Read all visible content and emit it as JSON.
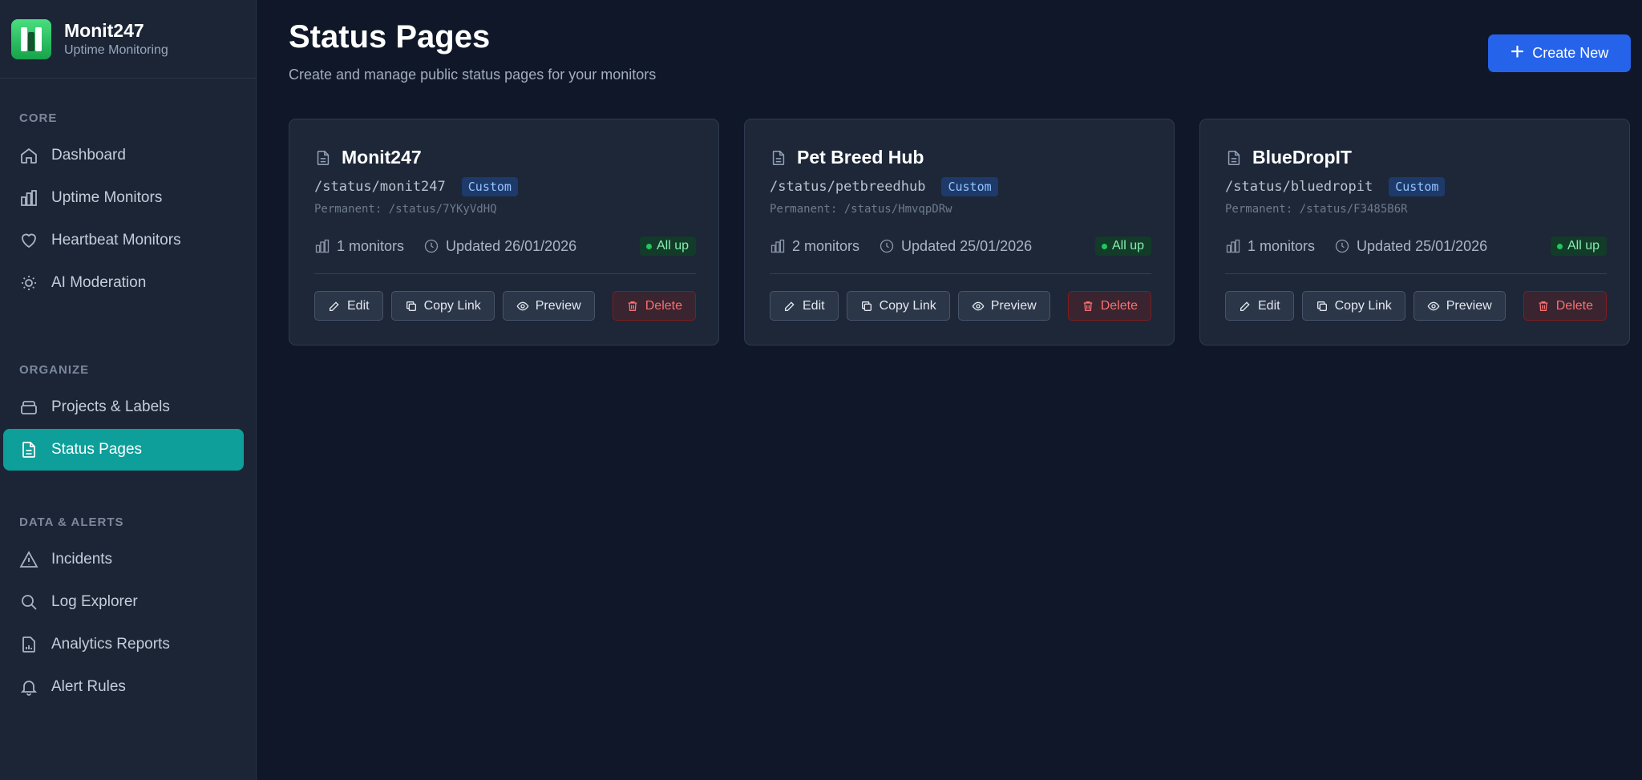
{
  "brand": {
    "name": "Monit247",
    "tagline": "Uptime Monitoring"
  },
  "sidebar": {
    "sections": [
      {
        "heading": "CORE",
        "items": [
          {
            "label": "Dashboard",
            "icon": "home-icon"
          },
          {
            "label": "Uptime Monitors",
            "icon": "bar-chart-icon"
          },
          {
            "label": "Heartbeat Monitors",
            "icon": "heart-icon"
          },
          {
            "label": "AI Moderation",
            "icon": "lightbulb-icon"
          }
        ]
      },
      {
        "heading": "ORGANIZE",
        "items": [
          {
            "label": "Projects & Labels",
            "icon": "archive-icon"
          },
          {
            "label": "Status Pages",
            "icon": "document-icon",
            "active": true
          }
        ]
      },
      {
        "heading": "DATA & ALERTS",
        "items": [
          {
            "label": "Incidents",
            "icon": "warning-icon"
          },
          {
            "label": "Log Explorer",
            "icon": "search-icon"
          },
          {
            "label": "Analytics Reports",
            "icon": "report-icon"
          },
          {
            "label": "Alert Rules",
            "icon": "bell-icon"
          }
        ]
      }
    ]
  },
  "header": {
    "title": "Status Pages",
    "subtitle": "Create and manage public status pages for your monitors",
    "create_label": "Create New"
  },
  "cards": [
    {
      "title": "Monit247",
      "slug": "/status/monit247",
      "badge": "Custom",
      "permanent": "Permanent: /status/7YKyVdHQ",
      "monitors": "1 monitors",
      "updated": "Updated 26/01/2026",
      "status": "All up"
    },
    {
      "title": "Pet Breed Hub",
      "slug": "/status/petbreedhub",
      "badge": "Custom",
      "permanent": "Permanent: /status/HmvqpDRw",
      "monitors": "2 monitors",
      "updated": "Updated 25/01/2026",
      "status": "All up"
    },
    {
      "title": "BlueDropIT",
      "slug": "/status/bluedropit",
      "badge": "Custom",
      "permanent": "Permanent: /status/F3485B6R",
      "monitors": "1 monitors",
      "updated": "Updated 25/01/2026",
      "status": "All up"
    }
  ],
  "card_actions": {
    "edit": "Edit",
    "copy": "Copy Link",
    "preview": "Preview",
    "delete": "Delete"
  },
  "colors": {
    "accent": "#0e9f9a",
    "primary_button": "#2563eb",
    "status_ok": "#22c55e",
    "danger": "#f87171"
  }
}
